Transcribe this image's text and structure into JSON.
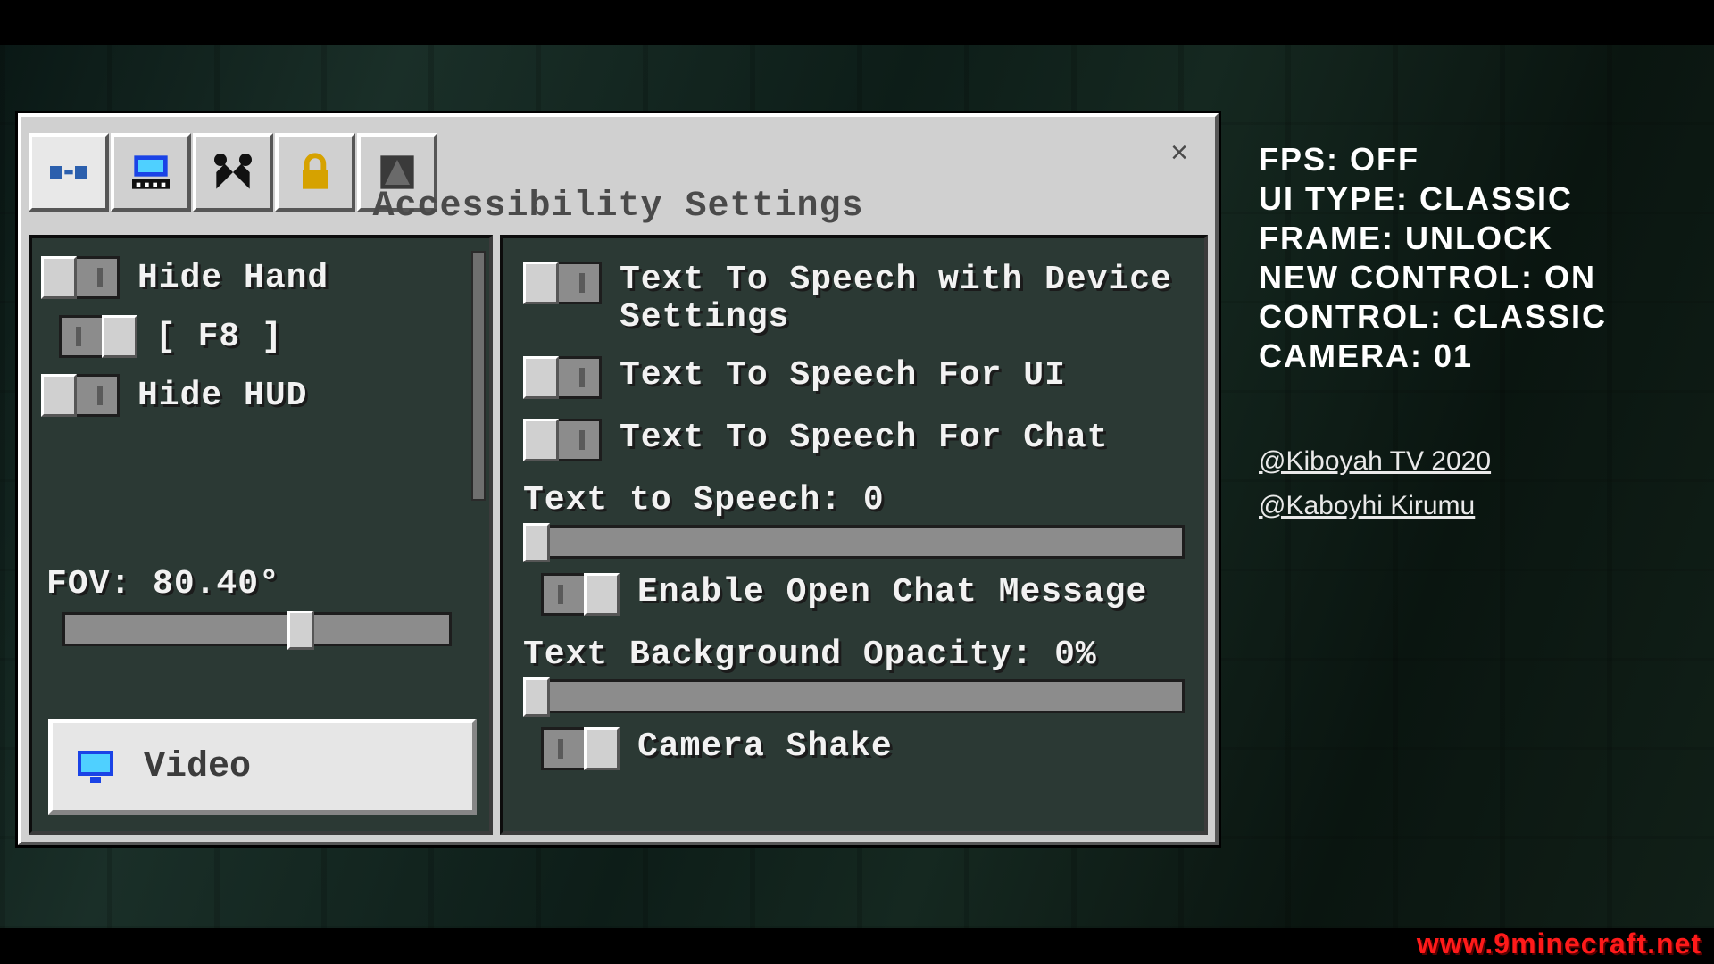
{
  "header": {
    "title": "Accessibility Settings",
    "close_glyph": "×"
  },
  "left": {
    "hide_hand": {
      "label": "Hide Hand",
      "state": "off"
    },
    "f8": {
      "label": "[ F8 ]",
      "state": "on"
    },
    "hide_hud": {
      "label": "Hide HUD",
      "state": "off"
    },
    "fov": {
      "label": "FOV: 80.40°",
      "pct": 58
    },
    "video_label": "Video"
  },
  "right": {
    "tts_device": {
      "label": "Text To Speech with Device Settings",
      "state": "off"
    },
    "tts_ui": {
      "label": "Text To Speech For UI",
      "state": "off"
    },
    "tts_chat": {
      "label": "Text To Speech For Chat",
      "state": "off"
    },
    "tts_slider": {
      "label": "Text to Speech: 0",
      "pct": 0
    },
    "open_chat": {
      "label": "Enable Open Chat Message",
      "state": "on"
    },
    "bg_opacity": {
      "label": "Text Background Opacity: 0%",
      "pct": 0
    },
    "camera_shake": {
      "label": "Camera Shake",
      "state": "on"
    }
  },
  "overlay": {
    "fps": "FPS: OFF",
    "ui_type": "UI TYPE: CLASSIC",
    "frame": "FRAME: UNLOCK",
    "new_control": "NEW CONTROL: ON",
    "control": "CONTROL: CLASSIC",
    "camera": "CAMERA: 01"
  },
  "credits": {
    "line1": "@Kiboyah TV 2020",
    "line2": "@Kaboyhi Kirumu"
  },
  "watermark": "www.9minecraft.net"
}
